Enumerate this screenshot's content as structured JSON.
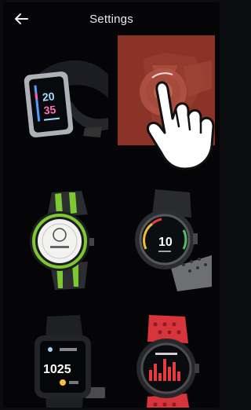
{
  "header": {
    "title": "Settings",
    "back_icon": "arrow-left-icon"
  },
  "watches": [
    {
      "name": "band-tracker",
      "time_top": "20",
      "time_bottom": "35",
      "selected": false
    },
    {
      "name": "round-outdoor",
      "selected": true
    },
    {
      "name": "green-sport",
      "selected": false
    },
    {
      "name": "gray-sport",
      "time": "10",
      "selected": false
    },
    {
      "name": "square-black",
      "time": "1025",
      "selected": false
    },
    {
      "name": "red-sport",
      "selected": false
    }
  ],
  "colors": {
    "background": "#050507",
    "selected_tile": "#8a3326",
    "green_strap": "#7ec832",
    "red_strap": "#d8343c"
  },
  "overlay": {
    "icon": "tap-hand-icon"
  }
}
